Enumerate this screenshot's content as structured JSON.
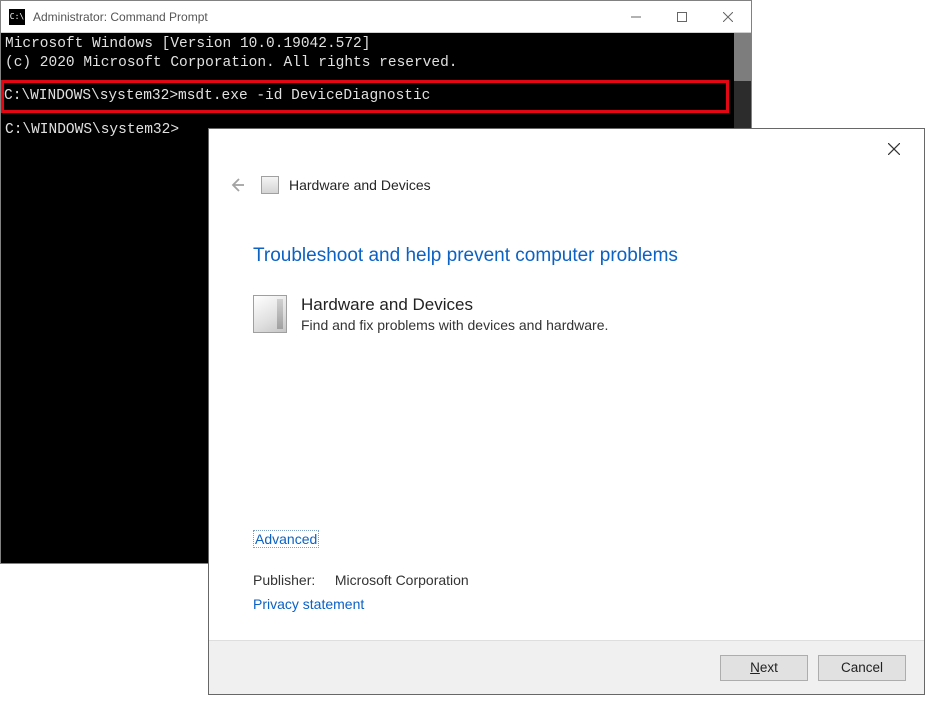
{
  "cmd": {
    "title": "Administrator: Command Prompt",
    "line1": "Microsoft Windows [Version 10.0.19042.572]",
    "line2": "(c) 2020 Microsoft Corporation. All rights reserved.",
    "prompt1_path": "C:\\WINDOWS\\system32>",
    "prompt1_cmd": "msdt.exe -id DeviceDiagnostic",
    "prompt2_path": "C:\\WINDOWS\\system32>"
  },
  "dialog": {
    "header_title": "Hardware and Devices",
    "heading": "Troubleshoot and help prevent computer problems",
    "section_title": "Hardware and Devices",
    "section_desc": "Find and fix problems with devices and hardware.",
    "advanced": "Advanced",
    "publisher_label": "Publisher:",
    "publisher_value": "Microsoft Corporation",
    "privacy": "Privacy statement",
    "btn_next_pre": "N",
    "btn_next_post": "ext",
    "btn_cancel": "Cancel"
  }
}
